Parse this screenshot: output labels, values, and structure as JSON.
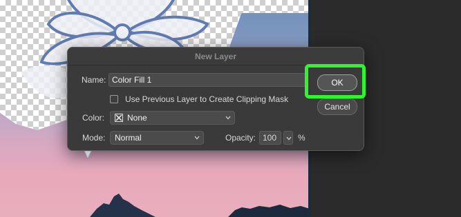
{
  "dialog": {
    "title": "New Layer",
    "name_label": "Name:",
    "name_value": "Color Fill 1",
    "clip_label": "Use Previous Layer to Create Clipping Mask",
    "clip_checked": false,
    "color_label": "Color:",
    "color_value": "None",
    "mode_label": "Mode:",
    "mode_value": "Normal",
    "opacity_label": "Opacity:",
    "opacity_value": "100",
    "opacity_unit": "%",
    "ok_label": "OK",
    "cancel_label": "Cancel"
  },
  "colors": {
    "highlight": "#2ff52f",
    "dialog_bg": "#3a3a3a",
    "workspace_bg": "#2b2b2b"
  },
  "icons": {
    "color_swatch": "none-swatch-icon",
    "dropdown": "chevron-down-icon"
  }
}
